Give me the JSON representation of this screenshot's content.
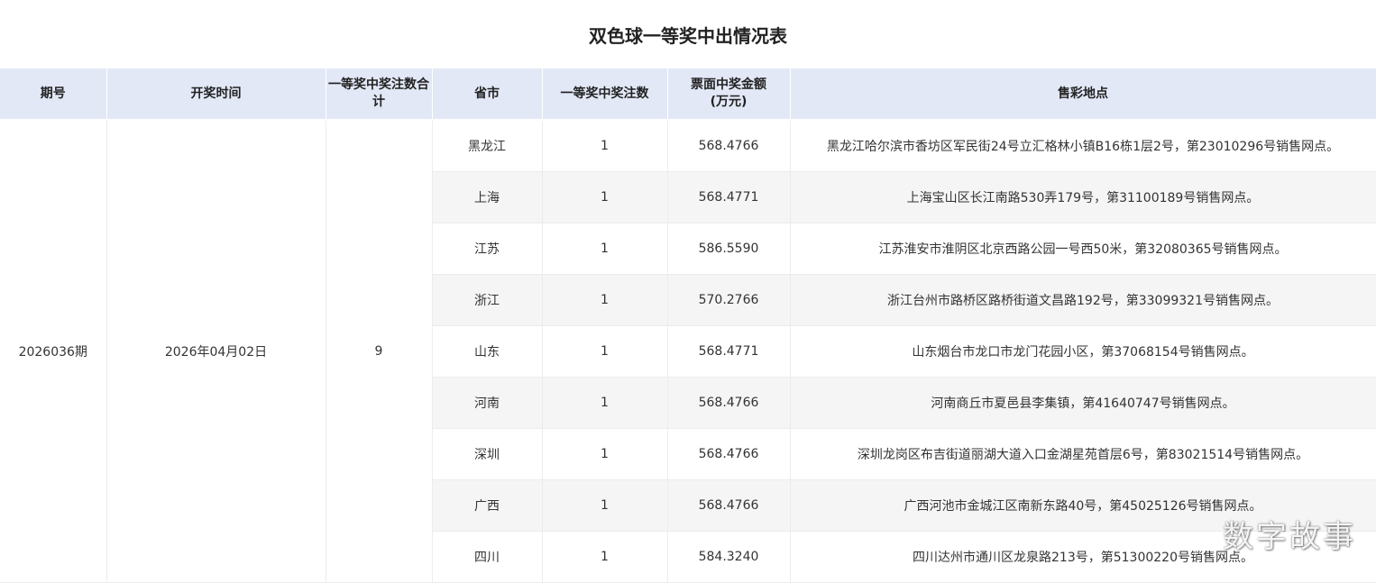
{
  "title": "双色球一等奖中出情况表",
  "columns": [
    "期号",
    "开奖时间",
    "一等奖中奖注数合计",
    "省市",
    "一等奖中奖注数",
    "票面中奖金额\n(万元)",
    "售彩地点"
  ],
  "draw": {
    "period": "2026036期",
    "date": "2026年04月02日",
    "total": "9"
  },
  "rows": [
    {
      "province": "黑龙江",
      "count": "1",
      "amount": "568.4766",
      "location": "黑龙江哈尔滨市香坊区军民街24号立汇格林小镇B16栋1层2号，第23010296号销售网点。"
    },
    {
      "province": "上海",
      "count": "1",
      "amount": "568.4771",
      "location": "上海宝山区长江南路530弄179号，第31100189号销售网点。"
    },
    {
      "province": "江苏",
      "count": "1",
      "amount": "586.5590",
      "location": "江苏淮安市淮阴区北京西路公园一号西50米，第32080365号销售网点。"
    },
    {
      "province": "浙江",
      "count": "1",
      "amount": "570.2766",
      "location": "浙江台州市路桥区路桥街道文昌路192号，第33099321号销售网点。"
    },
    {
      "province": "山东",
      "count": "1",
      "amount": "568.4771",
      "location": "山东烟台市龙口市龙门花园小区，第37068154号销售网点。"
    },
    {
      "province": "河南",
      "count": "1",
      "amount": "568.4766",
      "location": "河南商丘市夏邑县李集镇，第41640747号销售网点。"
    },
    {
      "province": "深圳",
      "count": "1",
      "amount": "568.4766",
      "location": "深圳龙岗区布吉街道丽湖大道入口金湖星苑首层6号，第83021514号销售网点。"
    },
    {
      "province": "广西",
      "count": "1",
      "amount": "568.4766",
      "location": "广西河池市金城江区南新东路40号，第45025126号销售网点。"
    },
    {
      "province": "四川",
      "count": "1",
      "amount": "584.3240",
      "location": "四川达州市通川区龙泉路213号，第51300220号销售网点。"
    }
  ],
  "watermark": "数字故事"
}
